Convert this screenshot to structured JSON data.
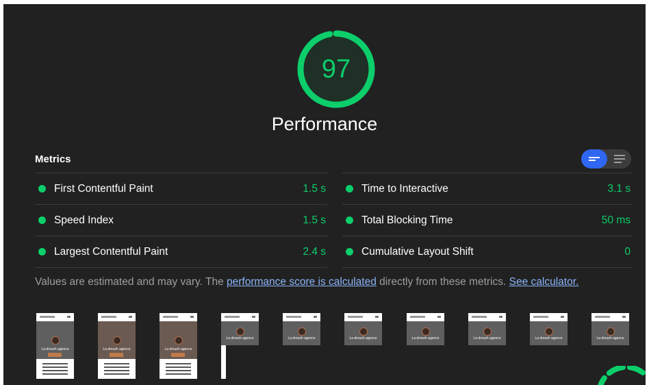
{
  "score": {
    "value": "97",
    "color": "#0cce6b",
    "fraction": 0.97
  },
  "category": {
    "title": "Performance"
  },
  "metrics": {
    "title": "Metrics",
    "left": [
      {
        "label": "First Contentful Paint",
        "value": "1.5 s"
      },
      {
        "label": "Speed Index",
        "value": "1.5 s"
      },
      {
        "label": "Largest Contentful Paint",
        "value": "2.4 s"
      }
    ],
    "right": [
      {
        "label": "Time to Interactive",
        "value": "3.1 s"
      },
      {
        "label": "Total Blocking Time",
        "value": "50 ms"
      },
      {
        "label": "Cumulative Layout Shift",
        "value": "0"
      }
    ]
  },
  "view_toggle": {
    "active": "compact",
    "accent": "#2f66f2"
  },
  "note": {
    "prefix": "Values are estimated and may vary. The",
    "link1": "performance score is calculated",
    "middle": "directly from these metrics.",
    "link2": "See calculator."
  },
  "filmstrip": {
    "frame_count": 10
  },
  "colors": {
    "pass": "#0cce6b",
    "background": "#212121",
    "link": "#8ab4f8"
  }
}
